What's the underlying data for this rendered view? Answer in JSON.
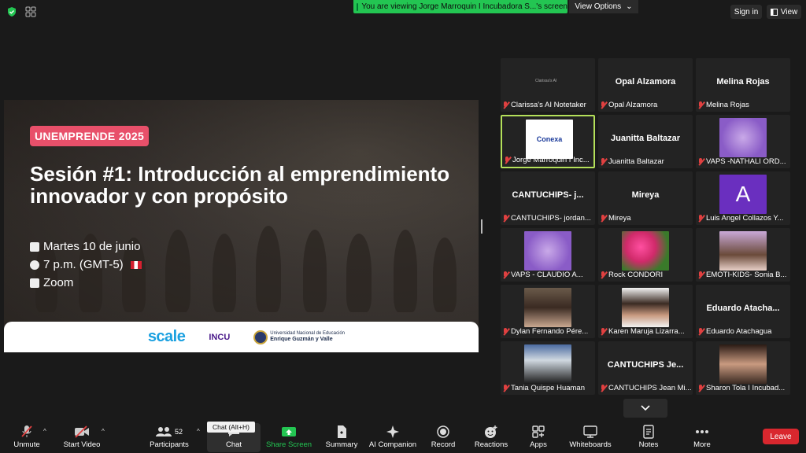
{
  "topbar": {
    "banner_text": "You are viewing Jorge Marroquin I Incubadora S...'s screen",
    "view_options": "View Options",
    "signin": "Sign in",
    "view": "View"
  },
  "slide": {
    "tag": "UNEMPRENDE 2025",
    "title": "Sesión #1: Introducción al emprendimiento innovador y con propósito",
    "date": "Martes 10 de junio",
    "time": "7 p.m. (GMT-5)",
    "platform": "Zoom",
    "logo_scale": "scale",
    "logo_incu": "INCU",
    "logo_une_1": "Universidad Nacional de Educación",
    "logo_une_2": "Enrique Guzmán y Valle"
  },
  "participants": [
    {
      "label": "Clarissa's AI Notetaker",
      "name": "",
      "pic": "notetaker"
    },
    {
      "label": "Opal Alzamora",
      "name": "Opal Alzamora",
      "pic": ""
    },
    {
      "label": "Melina Rojas",
      "name": "Melina Rojas",
      "pic": ""
    },
    {
      "label": "Jorge Marroquin I Inc...",
      "name": "",
      "pic": "conexa"
    },
    {
      "label": "Juanitta Baltazar",
      "name": "Juanitta Baltazar",
      "pic": ""
    },
    {
      "label": "VAPS -NATHALI ORD...",
      "name": "",
      "pic": "vaps"
    },
    {
      "label": "CANTUCHIPS- jordan...",
      "name": "CANTUCHIPS-  j...",
      "pic": ""
    },
    {
      "label": "Mireya",
      "name": "Mireya",
      "pic": ""
    },
    {
      "label": "Luis Angel Collazos Y...",
      "name": "",
      "pic": "avatar-a"
    },
    {
      "label": "VAPS - CLAUDIO A...",
      "name": "",
      "pic": "vaps"
    },
    {
      "label": "Rock CONDORI",
      "name": "",
      "pic": "flower"
    },
    {
      "label": "EMOTI-KIDS- Sonia B...",
      "name": "",
      "pic": "girl"
    },
    {
      "label": "Dylan Fernando Pére...",
      "name": "",
      "pic": "dylan"
    },
    {
      "label": "Karen Maruja Lizarra...",
      "name": "",
      "pic": "karen"
    },
    {
      "label": "Eduardo Atachagua",
      "name": "Eduardo  Atacha...",
      "pic": ""
    },
    {
      "label": "Tania Quispe Huaman",
      "name": "",
      "pic": "tania"
    },
    {
      "label": "CANTUCHIPS Jean Mi...",
      "name": "CANTUCHIPS  Je...",
      "pic": ""
    },
    {
      "label": "Sharon Tola I Incubad...",
      "name": "",
      "pic": "sharon"
    }
  ],
  "avatar_letter": "A",
  "notetaker_text": "Clarissa's AI",
  "conexa_text": "Conexa",
  "toolbar": {
    "unmute": "Unmute",
    "start_video": "Start Video",
    "participants": "Participants",
    "participants_count": "52",
    "chat": "Chat",
    "chat_tooltip": "Chat (Alt+H)",
    "share_screen": "Share Screen",
    "summary": "Summary",
    "ai_companion": "AI Companion",
    "record": "Record",
    "reactions": "Reactions",
    "apps": "Apps",
    "whiteboards": "Whiteboards",
    "notes": "Notes",
    "more": "More",
    "leave": "Leave"
  },
  "colors": {
    "accent_green": "#23c552",
    "leave_red": "#d9272e",
    "active_border": "#b4e05a",
    "tag_pink": "#e8506a"
  }
}
